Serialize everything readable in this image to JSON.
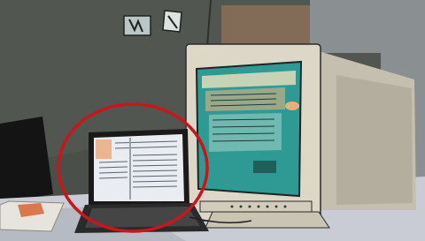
{
  "scene": {
    "description_label": "",
    "colors": {
      "wall": "#4a5049",
      "wall_right": "#8a9092",
      "door": "#826b57",
      "monitor_body": "#dcd7c6",
      "crt_screen": "#2f9a94",
      "laptop_screen": "#e9ecf0",
      "desk": "#c9ccd4",
      "highlight_circle": "#c8161c"
    },
    "highlight": {
      "shape": "ellipse",
      "target": "laptop"
    }
  }
}
